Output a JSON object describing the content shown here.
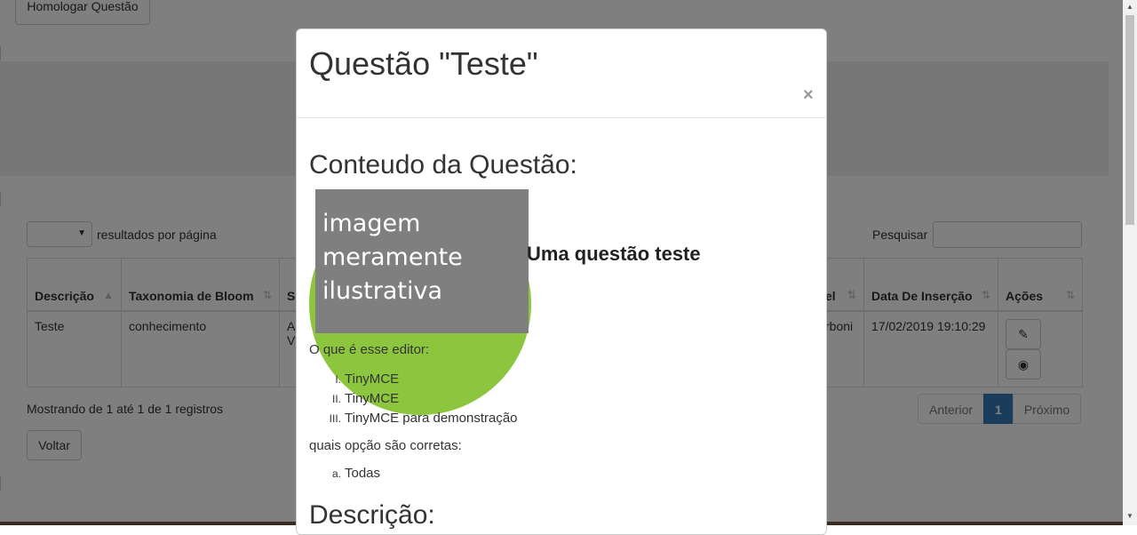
{
  "background": {
    "homologar_button": "Homologar Questão",
    "length_suffix": "resultados por página",
    "search_label": "Pesquisar",
    "table": {
      "headers": [
        {
          "label": "Descrição",
          "sort": "▲"
        },
        {
          "label": "Taxonomia de Bloom",
          "sort": "⇅"
        },
        {
          "label": "S",
          "sort": ""
        },
        {
          "label": "el",
          "sort": "⇅"
        },
        {
          "label": "Data De Inserção",
          "sort": "⇅"
        },
        {
          "label": "Ações",
          "sort": "⇅"
        }
      ],
      "row": {
        "descricao": "Teste",
        "taxonomia": "conhecimento",
        "col3": "A\nV",
        "col4": "rboni",
        "data": "17/02/2019 19:10:29"
      }
    },
    "info": "Mostrando de 1 até 1 de 1 registros",
    "pagination": {
      "prev": "Anterior",
      "current": "1",
      "next": "Próximo"
    },
    "back_button": "Voltar"
  },
  "modal": {
    "title": "Questão \"Teste\"",
    "close_symbol": "×",
    "content_heading": "Conteudo da Questão:",
    "image_caption": "imagem meramente ilustrativa",
    "question_heading": "Uma questão teste",
    "paragraph1": "O que é esse editor:",
    "roman_list": [
      {
        "marker": "I.",
        "text": "TinyMCE"
      },
      {
        "marker": "II.",
        "text": "TinyMCE"
      },
      {
        "marker": "III.",
        "text": "TinyMCE para demonstração"
      }
    ],
    "paragraph2": "quais opção são corretas:",
    "alpha_list": [
      {
        "marker": "a.",
        "text": "Todas"
      }
    ],
    "description_heading": "Descrição:"
  },
  "icons": {
    "edit": "pencil-icon",
    "view": "eye-icon",
    "scroll_up": "chevron-up-icon",
    "scroll_down": "chevron-down-icon"
  },
  "colors": {
    "backdrop": "rgba(0,0,0,0.5)",
    "accent": "#337ab7",
    "image_placeholder": "#7f7f7f",
    "green_circle": "#8cc63f"
  }
}
